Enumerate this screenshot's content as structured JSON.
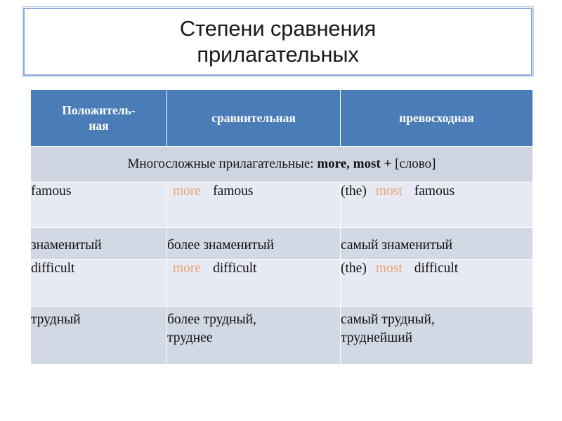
{
  "slide": {
    "title": "Степени сравнения\nприлагательных",
    "accent_color": "#4A7CB8",
    "keyword_color": "#E8A575",
    "row_light_color": "#E7EAF3",
    "row_dark_color": "#D2D8E4",
    "band_color": "#CED5E1"
  },
  "table": {
    "headers": [
      "Положитель-\nная",
      "сравнительная",
      "превосходная"
    ],
    "band": {
      "prefix": "Многосложные прилагательные: ",
      "keywords": "more, most +",
      "suffix": " [слово]"
    },
    "rows": [
      {
        "lang": "en",
        "positive": "famous",
        "comparative_keyword": "more",
        "comparative_word": "famous",
        "superlative_article": "(the)",
        "superlative_keyword": "most",
        "superlative_word": "famous"
      },
      {
        "lang": "ru",
        "positive": "знаменитый",
        "comparative": "более знаменитый",
        "superlative": "самый знаменитый"
      },
      {
        "lang": "en",
        "positive": "difficult",
        "comparative_keyword": "more",
        "comparative_word": "difficult",
        "superlative_article": "(the)",
        "superlative_keyword": "most",
        "superlative_word": "difficult"
      },
      {
        "lang": "ru",
        "positive": "трудный",
        "comparative": "более трудный,\nтруднее",
        "superlative": "самый трудный,\nтруднейший"
      }
    ]
  }
}
